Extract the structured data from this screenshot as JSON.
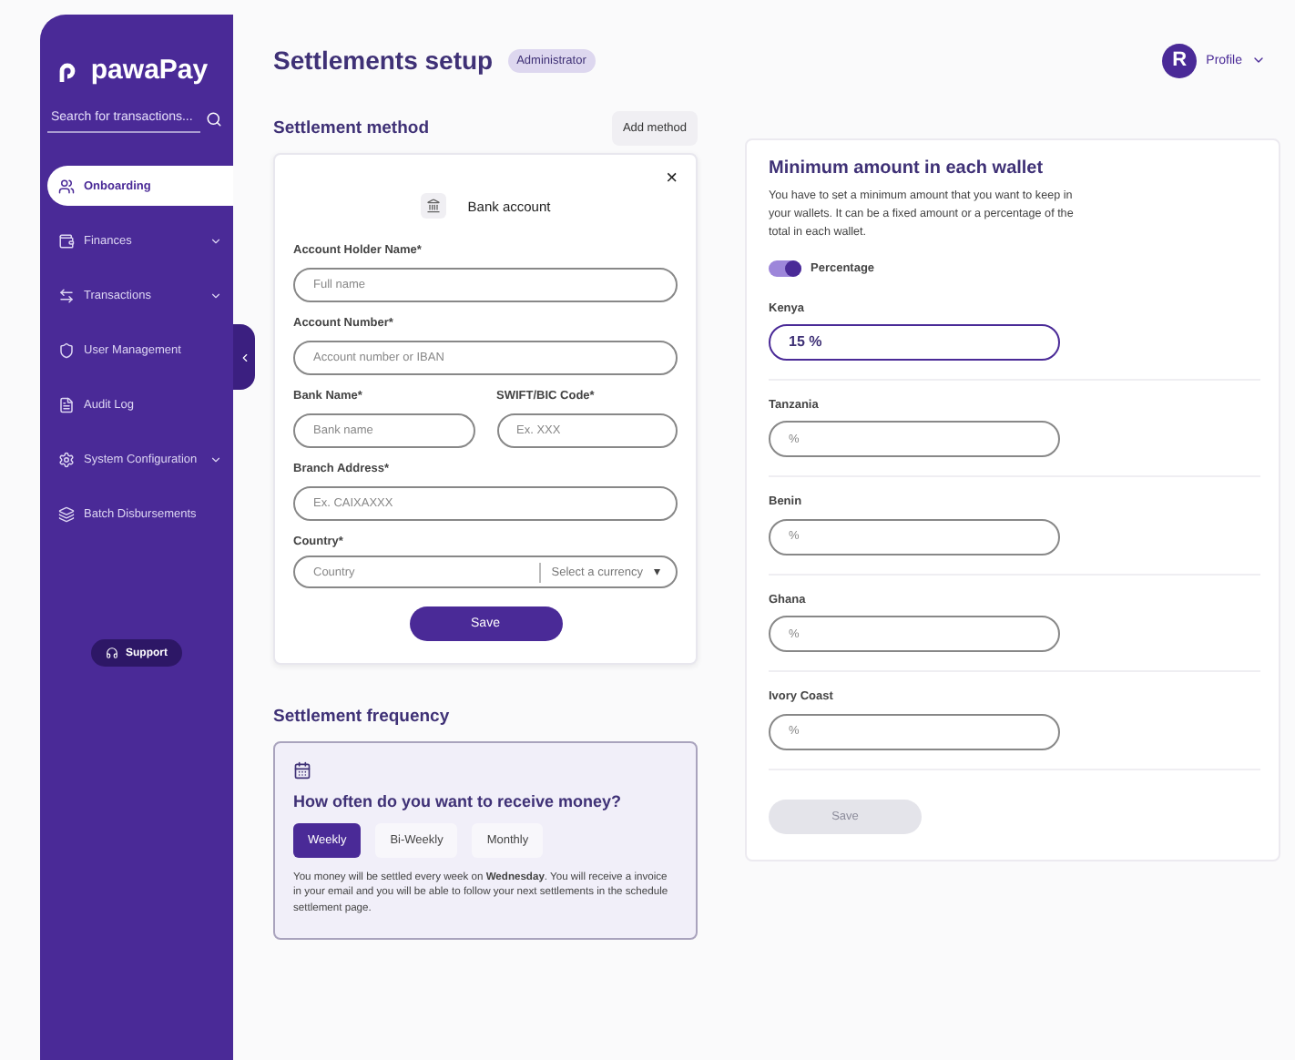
{
  "sidebar": {
    "logo": "pawaPay",
    "search": {
      "placeholder": "Search for transactions..."
    },
    "items": [
      {
        "label": "Onboarding",
        "selected": true,
        "expandable": false
      },
      {
        "label": "Finances",
        "selected": false,
        "expandable": true
      },
      {
        "label": "Transactions",
        "selected": false,
        "expandable": true
      },
      {
        "label": "User Management",
        "selected": false,
        "expandable": false
      },
      {
        "label": "Audit Log",
        "selected": false,
        "expandable": false
      },
      {
        "label": "System Configuration",
        "selected": false,
        "expandable": true
      },
      {
        "label": "Batch Disbursements",
        "selected": false,
        "expandable": false
      }
    ],
    "support": "Support"
  },
  "header": {
    "title": "Settlements setup",
    "badge": "Administrator",
    "profile": {
      "initial": "R",
      "label": "Profile"
    }
  },
  "settlement_method": {
    "title": "Settlement method",
    "add_button": "Add method",
    "card": {
      "close": "×",
      "method": "Bank account",
      "fields": [
        {
          "label": "Account Holder Name*",
          "placeholder": "Full name"
        },
        {
          "label": "Account Number*",
          "placeholder": "Account number or IBAN"
        },
        {
          "label": "Bank Name*",
          "placeholder": "Bank name",
          "half": true
        },
        {
          "label": "SWIFT/BIC Code*",
          "placeholder": "Ex. XXX",
          "half": true
        },
        {
          "label": "Branch Address*",
          "placeholder": "Ex. CAIXAXXX"
        }
      ],
      "country": {
        "label": "Country*",
        "placeholder": "Country",
        "currency": "Select a currency",
        "caret": "▾"
      },
      "save": "Save"
    }
  },
  "settlement_frequency": {
    "title": "Settlement frequency",
    "question": "How often do you want to receive money?",
    "options": [
      {
        "label": "Weekly",
        "selected": true
      },
      {
        "label": "Bi-Weekly",
        "selected": false
      },
      {
        "label": "Monthly",
        "selected": false
      }
    ],
    "note": "You money will be settled every week on **Wednesday**. You will receive a invoice in your email and you will be able to follow your next settlements in the schedule settlement page."
  },
  "minimum_amount": {
    "title": "Minimum amount in each wallet",
    "description": "You have to set a minimum amount that you want to keep in your wallets. It can be a fixed amount or a percentage of the total in each wallet.",
    "toggle": {
      "label": "Percentage",
      "on": true
    },
    "wallets": [
      {
        "country": "Kenya",
        "value": "15 %",
        "focused": true
      },
      {
        "country": "Tanzania",
        "placeholder": "%",
        "focused": false
      },
      {
        "country": "Benin",
        "placeholder": "%",
        "focused": false
      },
      {
        "country": "Ghana",
        "placeholder": "%",
        "focused": false
      },
      {
        "country": "Ivory Coast",
        "placeholder": "%",
        "focused": false
      }
    ],
    "save": {
      "label": "Save",
      "disabled": true
    }
  }
}
